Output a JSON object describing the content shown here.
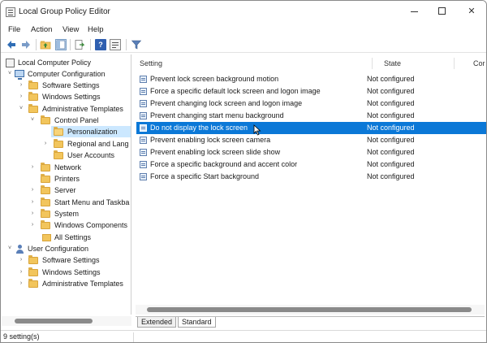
{
  "window": {
    "title": "Local Group Policy Editor",
    "close_glyph": "✕"
  },
  "menu": {
    "file": "File",
    "action": "Action",
    "view": "View",
    "help": "Help"
  },
  "toolbar": {
    "icons": [
      "back-arrow-icon",
      "forward-arrow-icon",
      "up-folder-icon",
      "show-hide-tree-icon",
      "export-list-icon",
      "help-icon",
      "properties-icon",
      "filter-icon"
    ],
    "help_glyph": "?",
    "accent_color": "#2f6db5"
  },
  "tree": {
    "root": "Local Computer Policy",
    "computer_configuration": "Computer Configuration",
    "software_settings": "Software Settings",
    "windows_settings": "Windows Settings",
    "administrative_templates": "Administrative Templates",
    "control_panel": "Control Panel",
    "personalization": "Personalization",
    "regional_and_lang": "Regional and Lang",
    "user_accounts": "User Accounts",
    "network": "Network",
    "printers": "Printers",
    "server": "Server",
    "start_menu": "Start Menu and Taskba",
    "system": "System",
    "windows_components": "Windows Components",
    "all_settings": "All Settings",
    "user_configuration": "User Configuration",
    "user_software_settings": "Software Settings",
    "user_windows_settings": "Windows Settings",
    "user_administrative_templates": "Administrative Templates",
    "selected_item": "Personalization"
  },
  "list": {
    "columns": {
      "setting": "Setting",
      "state": "State",
      "comment": "Cor"
    },
    "rows": [
      {
        "name": "Prevent lock screen background motion",
        "state": "Not configured"
      },
      {
        "name": "Force a specific default lock screen and logon image",
        "state": "Not configured"
      },
      {
        "name": "Prevent changing lock screen and logon image",
        "state": "Not configured"
      },
      {
        "name": "Prevent changing start menu background",
        "state": "Not configured"
      },
      {
        "name": "Do not display the lock screen",
        "state": "Not configured"
      },
      {
        "name": "Prevent enabling lock screen camera",
        "state": "Not configured"
      },
      {
        "name": "Prevent enabling lock screen slide show",
        "state": "Not configured"
      },
      {
        "name": "Force a specific background and accent color",
        "state": "Not configured"
      },
      {
        "name": "Force a specific Start background",
        "state": "Not configured"
      }
    ],
    "selected_index": 4,
    "selection_color": "#0b78d7"
  },
  "tabs": {
    "extended": "Extended",
    "standard": "Standard",
    "active": "Standard"
  },
  "status": {
    "text": "9 setting(s)"
  }
}
